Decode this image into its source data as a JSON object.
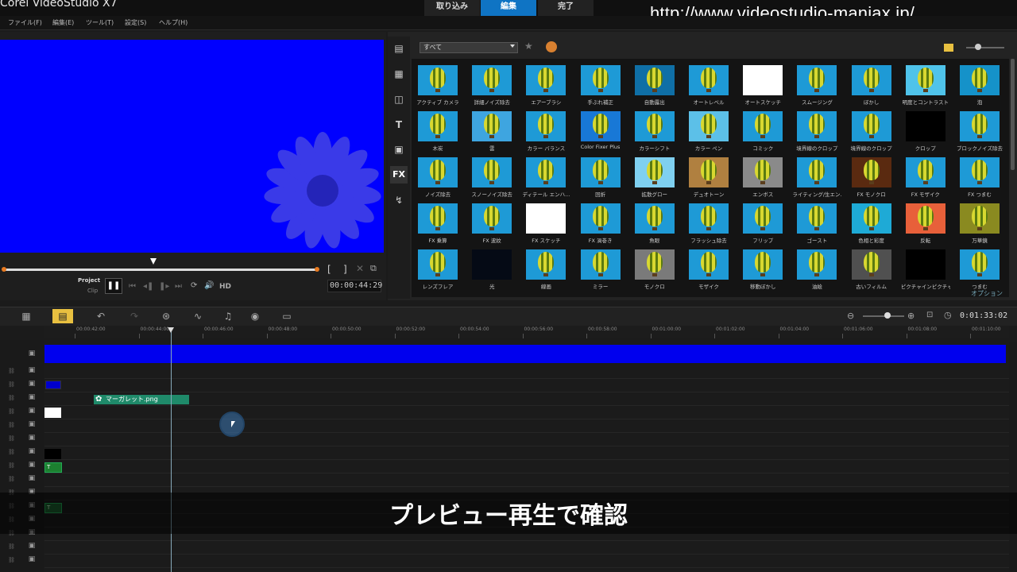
{
  "app": {
    "title": "Corel VideoStudio X7"
  },
  "steps": [
    {
      "label": "取り込み"
    },
    {
      "label": "編集"
    },
    {
      "label": "完了"
    }
  ],
  "watermark": "http://www.videostudio-maniax.jp/",
  "menu": [
    "ファイル(F)",
    "編集(E)",
    "ツール(T)",
    "設定(S)",
    "ヘルプ(H)"
  ],
  "preview": {
    "project_label": "Project",
    "clip_label": "Clip",
    "hd_label": "HD",
    "timecode": "00:00:44:29",
    "bracket_in": "[",
    "bracket_out": "]"
  },
  "library": {
    "filter": "すべて",
    "options_label": "オプション",
    "side_fx": "FX",
    "side_text": "T",
    "effects": [
      {
        "label": "アクティブ カメラ",
        "bg": "#1e9ad6"
      },
      {
        "label": "詳細ノイズ除去",
        "bg": "#1e9ad6"
      },
      {
        "label": "エアーブラシ",
        "bg": "#1e9ad6"
      },
      {
        "label": "手ぶれ補正",
        "bg": "#1e9ad6"
      },
      {
        "label": "自動露出",
        "bg": "#0f6fa6"
      },
      {
        "label": "オートレベル",
        "bg": "#1e9ad6"
      },
      {
        "label": "オートスケッチ",
        "bg": "#ffffff"
      },
      {
        "label": "スムージング",
        "bg": "#1e9ad6"
      },
      {
        "label": "ぼかし",
        "bg": "#1e9ad6"
      },
      {
        "label": "明度とコントラスト",
        "bg": "#4fc3ea"
      },
      {
        "label": "泡",
        "bg": "#1592c9"
      },
      {
        "label": "木炭",
        "bg": "#1e9ad6"
      },
      {
        "label": "雲",
        "bg": "#3ea5e0"
      },
      {
        "label": "カラー バランス",
        "bg": "#1e9ad6"
      },
      {
        "label": "Color Fixer Plus",
        "bg": "#1878d6"
      },
      {
        "label": "カラーシフト",
        "bg": "#1e9ad6"
      },
      {
        "label": "カラー ペン",
        "bg": "#5cc0e8"
      },
      {
        "label": "コミック",
        "bg": "#1e9ad6"
      },
      {
        "label": "境界線のクロップ",
        "bg": "#1e9ad6"
      },
      {
        "label": "境界線のクロップ",
        "bg": "#1e9ad6"
      },
      {
        "label": "クロップ",
        "bg": "#000000"
      },
      {
        "label": "ブロックノイズ除去",
        "bg": "#1e9ad6"
      },
      {
        "label": "ノイズ除去",
        "bg": "#1e9ad6"
      },
      {
        "label": "スノーノイズ除去",
        "bg": "#1e9ad6"
      },
      {
        "label": "ディテール エンハ...",
        "bg": "#1e9ad6"
      },
      {
        "label": "回折",
        "bg": "#1e9ad6"
      },
      {
        "label": "拡散グロー",
        "bg": "#7fd0f0"
      },
      {
        "label": "デュオトーン",
        "bg": "#b08040"
      },
      {
        "label": "エンボス",
        "bg": "#8a8a8a"
      },
      {
        "label": "ライティング/生エン...",
        "bg": "#1e9ad6"
      },
      {
        "label": "FX モノクロ",
        "bg": "#5a2a10"
      },
      {
        "label": "FX モザイク",
        "bg": "#1e9ad6"
      },
      {
        "label": "FX つまむ",
        "bg": "#1e9ad6"
      },
      {
        "label": "FX 乗算",
        "bg": "#1e9ad6"
      },
      {
        "label": "FX 波紋",
        "bg": "#1e9ad6"
      },
      {
        "label": "FX スケッチ",
        "bg": "#ffffff"
      },
      {
        "label": "FX 渦巻き",
        "bg": "#1e9ad6"
      },
      {
        "label": "魚眼",
        "bg": "#1e9ad6"
      },
      {
        "label": "フラッシュ除去",
        "bg": "#1e9ad6"
      },
      {
        "label": "フリップ",
        "bg": "#1e9ad6"
      },
      {
        "label": "ゴースト",
        "bg": "#1e9ad6"
      },
      {
        "label": "色相と彩度",
        "bg": "#1eaad6"
      },
      {
        "label": "反転",
        "bg": "#e8603a"
      },
      {
        "label": "万華鏡",
        "bg": "#8a8a20"
      },
      {
        "label": "レンズフレア",
        "bg": "#1e9ad6"
      },
      {
        "label": "光",
        "bg": "#050a15"
      },
      {
        "label": "線画",
        "bg": "#1e9ad6"
      },
      {
        "label": "ミラー",
        "bg": "#1e9ad6"
      },
      {
        "label": "モノクロ",
        "bg": "#7a7a7a"
      },
      {
        "label": "モザイク",
        "bg": "#1e9ad6"
      },
      {
        "label": "移動ぼかし",
        "bg": "#1e9ad6"
      },
      {
        "label": "油絵",
        "bg": "#1e9ad6"
      },
      {
        "label": "古いフィルム",
        "bg": "#505050"
      },
      {
        "label": "ピクチャインピクチャ",
        "bg": "#000000"
      },
      {
        "label": "つまむ",
        "bg": "#1e9ad6"
      }
    ]
  },
  "timeline": {
    "timecode": "0:01:33:02",
    "ticks": [
      "00:00:42:00",
      "00:00:44:00",
      "00:00:46:00",
      "00:00:48:00",
      "00:00:50:00",
      "00:00:52:00",
      "00:00:54:00",
      "00:00:56:00",
      "00:00:58:00",
      "00:01:00:00",
      "00:01:02:00",
      "00:01:04:00",
      "00:01:06:00",
      "00:01:08:00",
      "00:01:10:00"
    ],
    "clip_label": "マーガレット.png"
  },
  "subtitle": "プレビュー再生で確認"
}
